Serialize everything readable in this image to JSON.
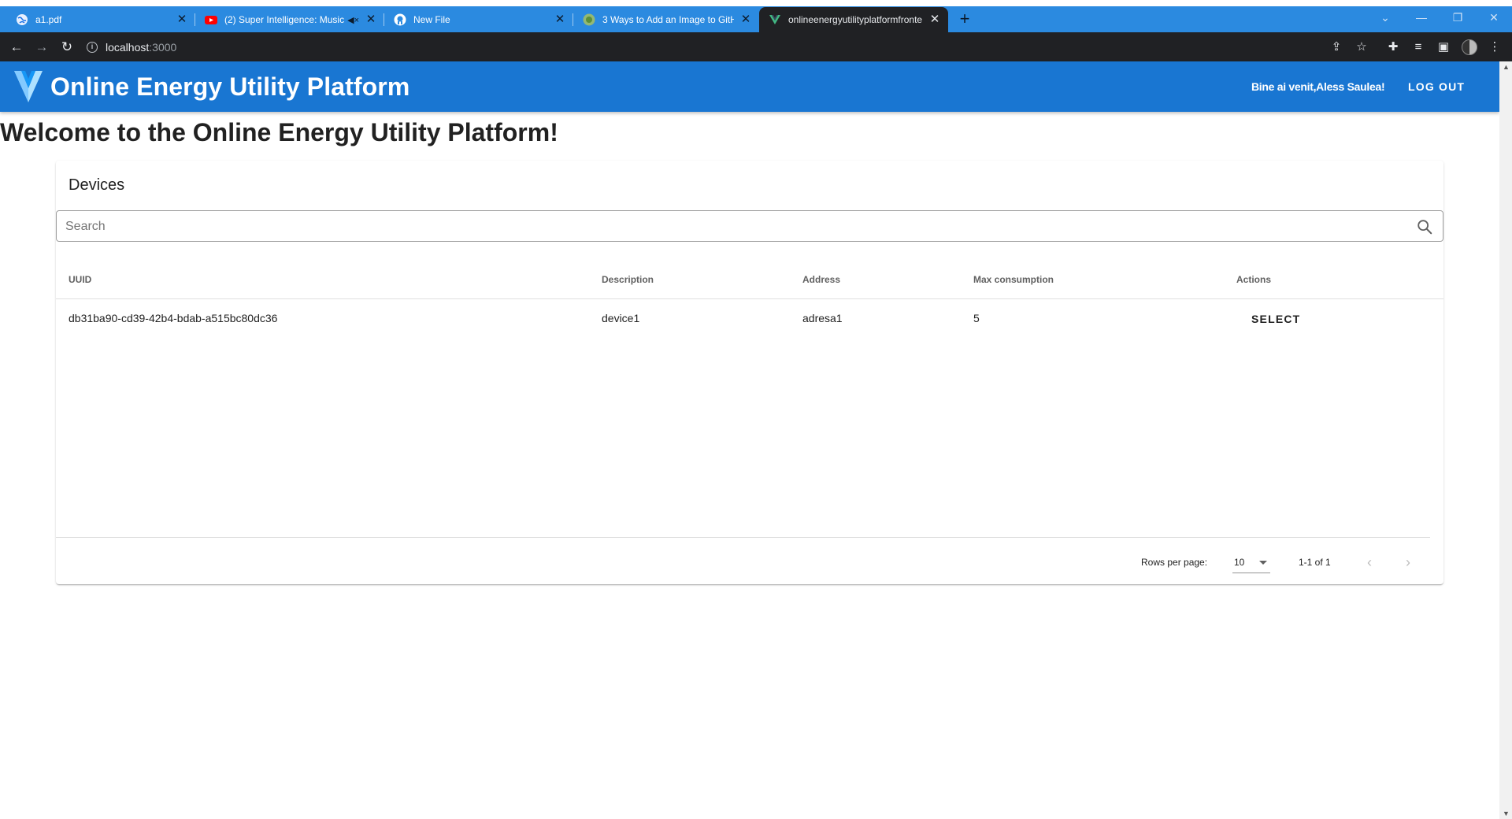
{
  "browser": {
    "tabs": [
      {
        "title": "a1.pdf",
        "favicon": "globe-icon"
      },
      {
        "title": "(2) Super Intelligence: Music",
        "favicon": "youtube-icon"
      },
      {
        "title": "New File",
        "favicon": "github-icon"
      },
      {
        "title": "3 Ways to Add an Image to GitH",
        "favicon": "wikihow-icon"
      },
      {
        "title": "onlineenergyutilityplatformfronte",
        "favicon": "vue-icon"
      }
    ],
    "url_host": "localhost",
    "url_port": ":3000",
    "tab_bar_color": "#2b8ae0",
    "toolbar_color": "#202124"
  },
  "appbar": {
    "title": "Online Energy Utility Platform",
    "greeting_prefix": "Bine ai venit,",
    "user_name": "Aless Saulea!",
    "logout_label": "LOG OUT",
    "color": "#1976d2"
  },
  "page": {
    "welcome": "Welcome to the Online Energy Utility Platform!"
  },
  "devices": {
    "title": "Devices",
    "search_placeholder": "Search",
    "columns": [
      "UUID",
      "Description",
      "Address",
      "Max consumption",
      "Actions"
    ],
    "rows": [
      {
        "uuid": "db31ba90-cd39-42b4-bdab-a515bc80dc36",
        "description": "device1",
        "address": "adresa1",
        "max_consumption": "5",
        "action_label": "SELECT"
      }
    ],
    "footer": {
      "rows_per_page_label": "Rows per page:",
      "rows_per_page_value": "10",
      "range_text": "1-1 of 1"
    }
  }
}
